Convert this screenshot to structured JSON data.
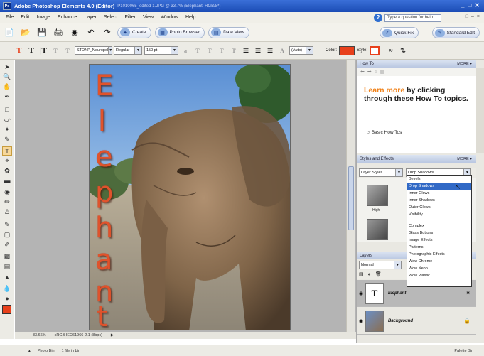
{
  "window": {
    "title": "Adobe Photoshop Elements 4.0 (Editor)",
    "doc_info": "P1010065_edited-1.JPG @ 33.7% (Elephant, RGB/8*)",
    "controls": [
      "_",
      "□",
      "✕"
    ]
  },
  "menubar": {
    "items": [
      "File",
      "Edit",
      "Image",
      "Enhance",
      "Layer",
      "Select",
      "Filter",
      "View",
      "Window",
      "Help"
    ],
    "help_placeholder": "Type a question for help",
    "right_controls": [
      "□",
      "–",
      "×"
    ]
  },
  "shortcuts": {
    "create_label": "Create",
    "photo_browser_label": "Photo Browser",
    "date_view_label": "Date View",
    "quick_fix_label": "Quick Fix",
    "standard_edit_label": "Standard Edit"
  },
  "options_bar": {
    "font_family": "STONP_Neuropol",
    "font_style": "Regular",
    "font_size": "150 pt",
    "leading": "(Auto)",
    "color_label": "Color:",
    "style_label": "Style:",
    "text_color": "#e8401b"
  },
  "canvas": {
    "text": "Elephant",
    "text_color": "#e0532c"
  },
  "status": {
    "zoom": "33.66%",
    "profile": "sRGB IEC61966-2.1 (8bpc)"
  },
  "bottom": {
    "photo_bin_label": "Photo Bin",
    "files_in_bin": "1 file in bin",
    "palette_bin_label": "Palette Bin"
  },
  "howto": {
    "header": "How To",
    "more_label": "MORE ▸",
    "highlight": "Learn more",
    "text_rest": "by clicking through these How To topics.",
    "link": "Basic How Tos"
  },
  "styles": {
    "header": "Styles and Effects",
    "more_label": "MORE ▸",
    "category": "Layer Styles",
    "selected": "Drop Shadows",
    "tile_label": "High",
    "options_group1": [
      "Bevels",
      "Drop Shadows",
      "Inner Glows",
      "Inner Shadows",
      "Outer Glows",
      "Visibility"
    ],
    "options_group2": [
      "Complex",
      "Glass Buttons",
      "Image Effects",
      "Patterns",
      "Photographic Effects",
      "Wow Chrome",
      "Wow Neon",
      "Wow Plastic"
    ]
  },
  "layers": {
    "header": "Layers",
    "blend_mode": "Normal",
    "items": [
      {
        "name": "Elephant",
        "thumb": "T",
        "selected": true
      },
      {
        "name": "Background",
        "thumb": "",
        "selected": false
      }
    ]
  }
}
